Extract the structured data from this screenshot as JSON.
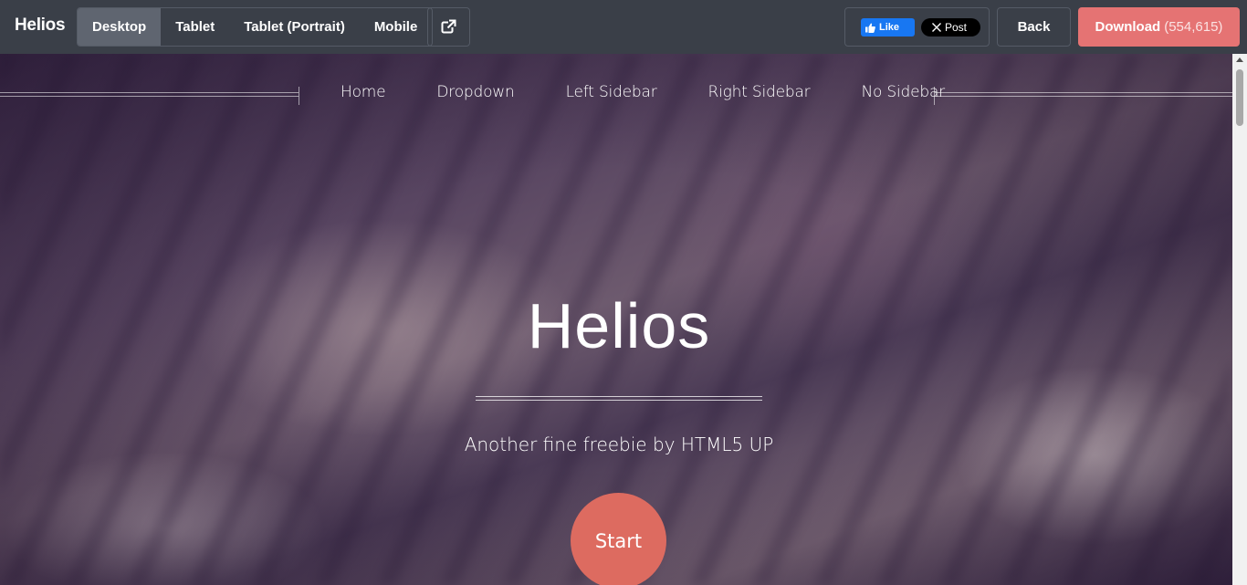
{
  "toolbar": {
    "brand": "Helios",
    "devices": [
      {
        "label": "Desktop",
        "active": true
      },
      {
        "label": "Tablet",
        "active": false
      },
      {
        "label": "Tablet (Portrait)",
        "active": false
      },
      {
        "label": "Mobile",
        "active": false
      }
    ],
    "open_external_icon": "external-link-icon",
    "social": {
      "fb_like_label": "Like",
      "x_post_label": "Post"
    },
    "back_label": "Back",
    "download_label": "Download",
    "download_count": "(554,615)",
    "accent_color": "#e57373"
  },
  "site": {
    "nav": [
      "Home",
      "Dropdown",
      "Left Sidebar",
      "Right Sidebar",
      "No Sidebar"
    ],
    "title": "Helios",
    "subtitle": "Another fine freebie by HTML5 UP",
    "start_label": "Start",
    "start_color": "#dd6b60"
  }
}
